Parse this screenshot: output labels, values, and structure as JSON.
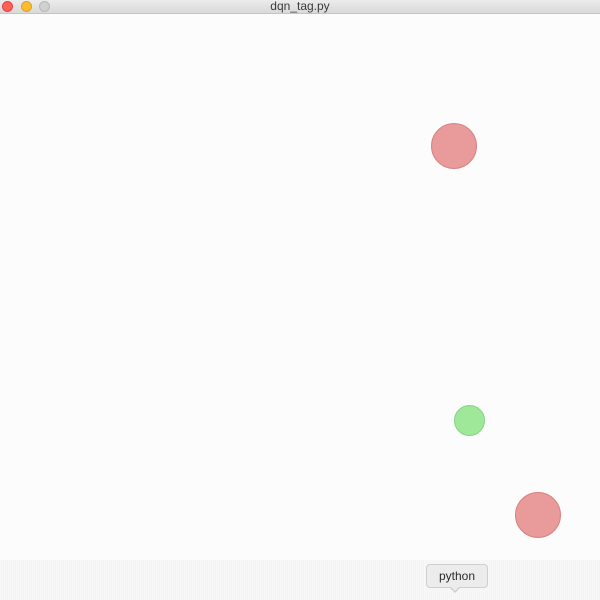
{
  "window": {
    "title": "dqn_tag.py"
  },
  "canvas": {
    "agents": [
      {
        "role": "chaser",
        "color": "#e99a9a",
        "border": "#d88282"
      },
      {
        "role": "chaser",
        "color": "#e99a9a",
        "border": "#d88282"
      },
      {
        "role": "runner",
        "color": "#9fe89a",
        "border": "#85d480"
      }
    ]
  },
  "dock": {
    "tooltip_label": "python"
  },
  "colors": {
    "close": "#fc5f57",
    "minimize": "#fdbc2e",
    "zoom_inactive": "#d0d0d0"
  }
}
